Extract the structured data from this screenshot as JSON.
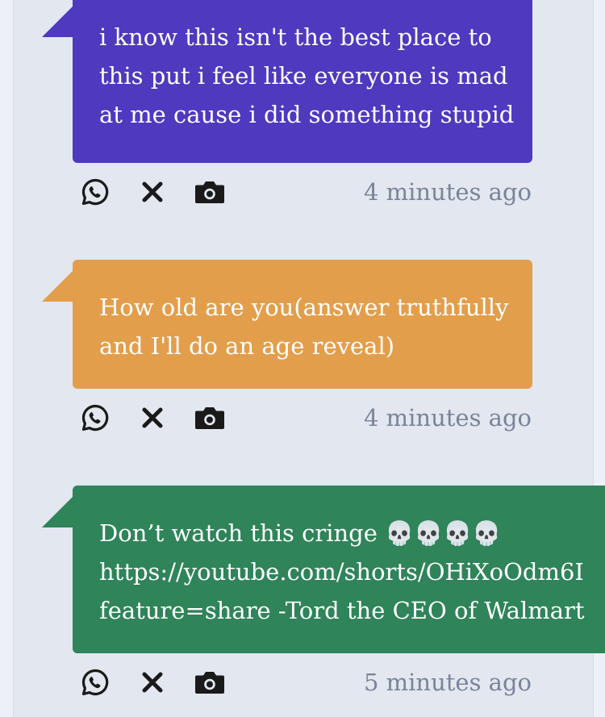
{
  "messages": [
    {
      "text": "i know this isn't the best place to\nthis put i feel like everyone is mad\nat me cause i did something stupid",
      "color": "#4f39bf",
      "timestamp": "4 minutes ago"
    },
    {
      "text": "How old are you(answer truthfully\nand I'll do an age reveal)",
      "color": "#e39e4c",
      "timestamp": "4 minutes ago"
    },
    {
      "text": "Don’t watch this cringe 💀💀💀💀\nhttps://youtube.com/shorts/OHiXoOdm6I\nfeature=share -Tord the CEO of Walmart",
      "color": "#2f8459",
      "timestamp": "5 minutes ago"
    }
  ],
  "actions": {
    "whatsapp_icon": "whatsapp-icon",
    "x_icon": "x-icon",
    "camera_icon": "camera-icon"
  }
}
